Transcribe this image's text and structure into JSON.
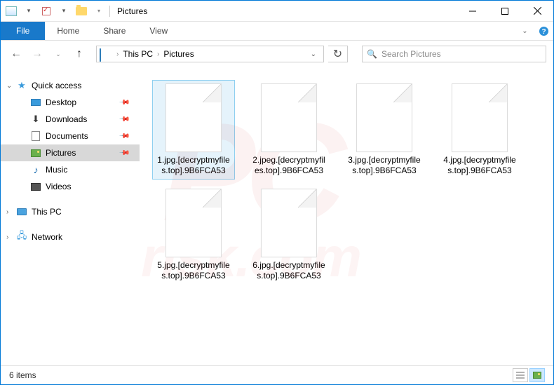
{
  "title": "Pictures",
  "ribbon": {
    "file": "File",
    "tabs": [
      "Home",
      "Share",
      "View"
    ]
  },
  "breadcrumb": {
    "segments": [
      "This PC",
      "Pictures"
    ]
  },
  "search": {
    "placeholder": "Search Pictures"
  },
  "sidebar": {
    "quick_access": "Quick access",
    "items": [
      {
        "label": "Desktop",
        "pinned": true
      },
      {
        "label": "Downloads",
        "pinned": true
      },
      {
        "label": "Documents",
        "pinned": true
      },
      {
        "label": "Pictures",
        "pinned": true,
        "selected": true
      },
      {
        "label": "Music"
      },
      {
        "label": "Videos"
      }
    ],
    "this_pc": "This PC",
    "network": "Network"
  },
  "files": [
    {
      "name": "1.jpg.[decryptmyfiles.top].9B6FCA53",
      "selected": true
    },
    {
      "name": "2.jpeg.[decryptmyfiles.top].9B6FCA53"
    },
    {
      "name": "3.jpg.[decryptmyfiles.top].9B6FCA53"
    },
    {
      "name": "4.jpg.[decryptmyfiles.top].9B6FCA53"
    },
    {
      "name": "5.jpg.[decryptmyfiles.top].9B6FCA53"
    },
    {
      "name": "6.jpg.[decryptmyfiles.top].9B6FCA53"
    }
  ],
  "status": {
    "count": "6 items"
  }
}
